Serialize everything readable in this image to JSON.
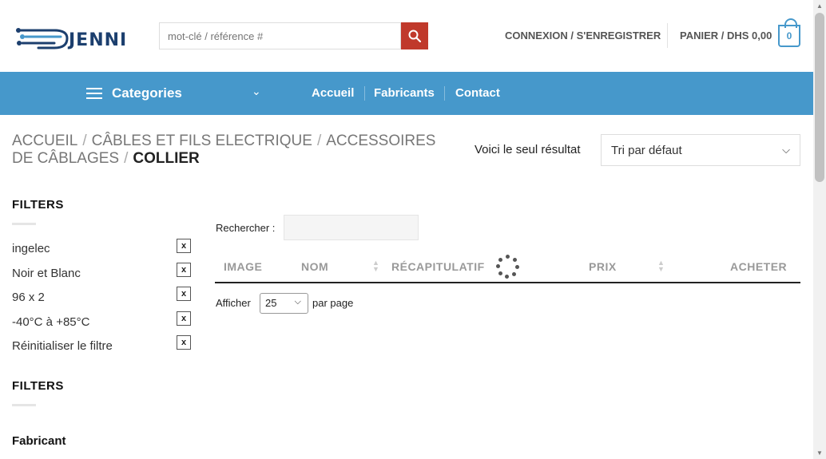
{
  "header": {
    "logo_text": "JENNI",
    "search_placeholder": "mot-clé / référence #",
    "login_label": "CONNEXION / S'ENREGISTRER",
    "cart_label": "PANIER / DHS 0,00",
    "cart_count": "0"
  },
  "nav": {
    "categories_label": "Categories",
    "links": [
      "Accueil",
      "Fabricants",
      "Contact"
    ]
  },
  "breadcrumb": {
    "items": [
      "ACCUEIL",
      "CÂBLES ET FILS ELECTRIQUE",
      "ACCESSOIRES DE CÂBLAGES"
    ],
    "current": "COLLIER",
    "separator": "/"
  },
  "results": {
    "text": "Voici le seul résultat",
    "sort_selected": "Tri par défaut"
  },
  "sidebar": {
    "heading1": "FILTERS",
    "active_filters": [
      "ingelec",
      "Noir et Blanc",
      "96 x 2",
      "-40°C à +85°C",
      "Réinitialiser le filtre"
    ],
    "remove_symbol": "x",
    "heading2": "FILTERS",
    "sub_heading": "Fabricant"
  },
  "table": {
    "search_label": "Rechercher :",
    "columns": [
      "IMAGE",
      "NOM",
      "RÉCAPITULATIF",
      "PRIX",
      "ACHETER"
    ],
    "show_label": "Afficher",
    "per_page_value": "25",
    "per_page_suffix": "par page"
  },
  "colors": {
    "nav_bg": "#4698cb",
    "search_button": "#c0392b",
    "logo_dark": "#1c3f6e"
  }
}
